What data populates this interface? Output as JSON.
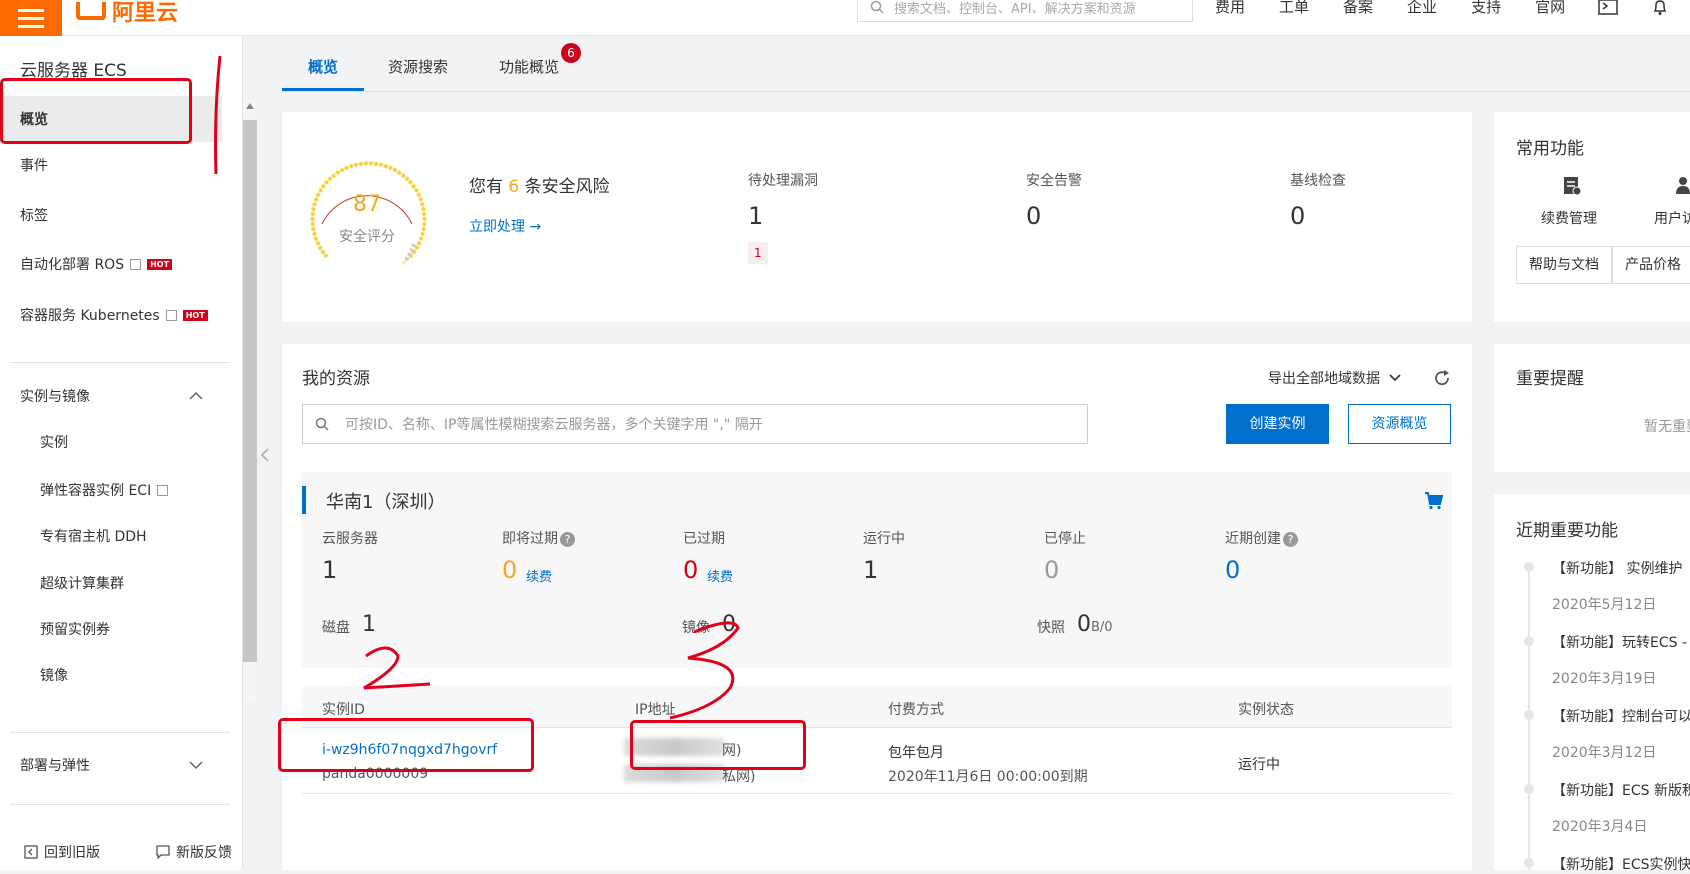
{
  "header": {
    "logo_text": "阿里云",
    "search_placeholder": "搜索文档、控制台、API、解决方案和资源",
    "nav": [
      "费用",
      "工单",
      "备案",
      "企业",
      "支持",
      "官网"
    ]
  },
  "sidebar": {
    "title": "云服务器 ECS",
    "items": [
      {
        "label": "概览"
      },
      {
        "label": "事件"
      },
      {
        "label": "标签"
      },
      {
        "label": "自动化部署 ROS",
        "hot": "HOT"
      },
      {
        "label": "容器服务 Kubernetes",
        "hot": "HOT"
      }
    ],
    "group1": "实例与镜像",
    "group1_items": [
      "实例",
      "弹性容器实例 ECI",
      "专有宿主机 DDH",
      "超级计算集群",
      "预留实例券",
      "镜像"
    ],
    "group2": "部署与弹性",
    "bottom_left": "回到旧版",
    "bottom_right": "新版反馈"
  },
  "tabs": {
    "items": [
      "概览",
      "资源搜索",
      "功能概览"
    ],
    "badge": "6"
  },
  "security": {
    "score": "87",
    "score_label": "安全评分",
    "risk_prefix": "您有",
    "risk_count": "6",
    "risk_suffix": "条安全风险",
    "action": "立即处理 →",
    "stats": [
      {
        "label": "待处理漏洞",
        "value": "1",
        "tag": "1"
      },
      {
        "label": "安全告警",
        "value": "0"
      },
      {
        "label": "基线检查",
        "value": "0"
      }
    ]
  },
  "resources": {
    "title": "我的资源",
    "export": "导出全部地域数据",
    "search_placeholder": "可按ID、名称、IP等属性模糊搜索云服务器，多个关键字用 \",\" 隔开",
    "create_btn": "创建实例",
    "overview_btn": "资源概览",
    "region": "华南1（深圳）",
    "stats": [
      {
        "label": "云服务器",
        "value": "1"
      },
      {
        "label": "即将过期",
        "value": "0",
        "link": "续费"
      },
      {
        "label": "已过期",
        "value": "0",
        "link": "续费"
      },
      {
        "label": "运行中",
        "value": "1"
      },
      {
        "label": "已停止",
        "value": "0"
      },
      {
        "label": "近期创建",
        "value": "0"
      }
    ],
    "disk_label": "磁盘",
    "disk_value": "1",
    "image_label": "镜像",
    "image_value": "0",
    "snapshot_label": "快照",
    "snapshot_value": "0",
    "snapshot_unit": "B/0",
    "table_headers": [
      "实例ID",
      "IP地址",
      "付费方式",
      "实例状态"
    ],
    "row": {
      "id": "i-wz9h6f07nqgxd7hgovrf",
      "name": "panda0000009",
      "ip1_suffix": "网)",
      "ip2_suffix": "私网)",
      "pay_type": "包年包月",
      "expire": "2020年11月6日 00:00:00到期",
      "status": "运行中"
    }
  },
  "right": {
    "common_title": "常用功能",
    "common_items": [
      "续费管理",
      "用户访"
    ],
    "buttons": [
      "帮助与文档",
      "产品价格"
    ],
    "notice_title": "重要提醒",
    "notice_empty": "暂无重要",
    "recent_title": "近期重要功能",
    "recent": [
      {
        "title": "【新功能】 实例维护",
        "date": "2020年5月12日"
      },
      {
        "title": "【新功能】玩转ECS -",
        "date": "2020年3月19日"
      },
      {
        "title": "【新功能】控制台可以",
        "date": "2020年3月12日"
      },
      {
        "title": "【新功能】ECS 新版积",
        "date": "2020年3月4日"
      },
      {
        "title": "【新功能】ECS实例快"
      }
    ]
  },
  "annotations": {
    "mark1": "1",
    "mark2": "2",
    "mark3": "3"
  }
}
